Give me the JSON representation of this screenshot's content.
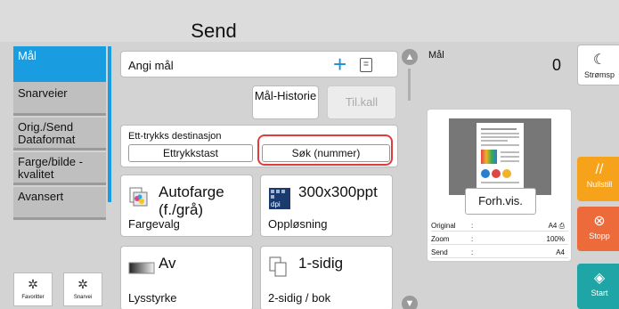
{
  "header": {
    "title": "Send"
  },
  "tabs": [
    {
      "label": "Mål"
    },
    {
      "label": "Snarveier"
    },
    {
      "label": "Orig./Send Dataformat"
    },
    {
      "label": "Farge/bilde -kvalitet"
    },
    {
      "label": "Avansert"
    }
  ],
  "bottom_buttons": {
    "favorites": "Favoritter",
    "shortcuts": "Snarvei"
  },
  "destination": {
    "label": "Angi mål",
    "history": "Mål-Historie",
    "recall": "Til.kall"
  },
  "one_touch": {
    "label": "Ett-trykks destinasjon",
    "key_button": "Ettrykkstast",
    "search_button": "Søk (nummer)"
  },
  "tiles": {
    "color": {
      "value": "Autofarge (f./grå)",
      "label": "Fargevalg"
    },
    "resolution": {
      "value": "300x300ppt",
      "label": "Oppløsning",
      "icon_text": "dpi"
    },
    "density": {
      "value": "Av",
      "label": "Lysstyrke"
    },
    "duplex": {
      "value": "1-sidig",
      "label": "2-sidig / bok"
    }
  },
  "preview": {
    "title": "Mål",
    "count": "0",
    "button": "Forh.vis.",
    "info": [
      {
        "key": "Original",
        "value": "A4 ⎙"
      },
      {
        "key": "Zoom",
        "value": "100%"
      },
      {
        "key": "Send",
        "value": "A4"
      }
    ]
  },
  "side_buttons": {
    "power": "Strømsp",
    "reset": "Nullstill",
    "stop": "Stopp",
    "start": "Start"
  }
}
